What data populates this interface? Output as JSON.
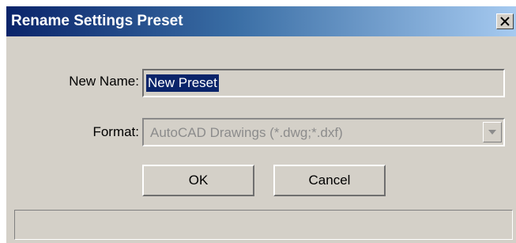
{
  "window": {
    "title": "Rename Settings Preset",
    "close_icon": "close-icon"
  },
  "form": {
    "name_label": "New Name:",
    "name_value": "New Preset",
    "format_label": "Format:",
    "format_value": "AutoCAD Drawings (*.dwg;*.dxf)",
    "format_arrow_icon": "chevron-down-icon"
  },
  "buttons": {
    "ok_label": "OK",
    "cancel_label": "Cancel"
  },
  "status": {
    "text": ""
  },
  "colors": {
    "title_bar_start": "#0a246a",
    "title_bar_end": "#a6caf0",
    "dialog_face": "#d4d0c8",
    "selection": "#0a246a",
    "disabled_text": "#8c8c8c"
  }
}
